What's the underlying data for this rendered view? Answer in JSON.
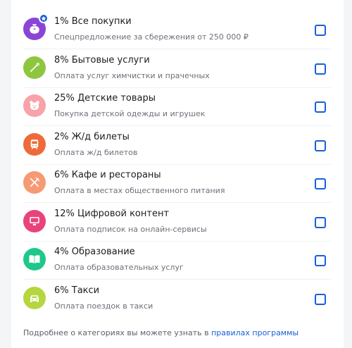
{
  "categories": [
    {
      "title": "1% Все покупки",
      "desc": "Спецпредложение за сбережения от 250 000 ₽",
      "icon": "wallet-icon",
      "color": "#8b45d6"
    },
    {
      "title": "8% Бытовые услуги",
      "desc": "Оплата услуг химчистки и прачечных",
      "icon": "needle-icon",
      "color": "#8ec63f"
    },
    {
      "title": "25% Детские товары",
      "desc": "Покупка детской одежды и игрушек",
      "icon": "teddy-bear-icon",
      "color": "#f7a3a9"
    },
    {
      "title": "2% Ж/д билеты",
      "desc": "Оплата ж/д билетов",
      "icon": "train-icon",
      "color": "#ee6a3a"
    },
    {
      "title": "6% Кафе и рестораны",
      "desc": "Оплата в местах общественного питания",
      "icon": "cutlery-icon",
      "color": "#f59a74"
    },
    {
      "title": "12% Цифровой контент",
      "desc": "Оплата подписок на онлайн-сервисы",
      "icon": "monitor-icon",
      "color": "#e9437a"
    },
    {
      "title": "4% Образование",
      "desc": "Оплата образовательных услуг",
      "icon": "book-icon",
      "color": "#1ec88a"
    },
    {
      "title": "6% Такси",
      "desc": "Оплата поездок в такси",
      "icon": "car-icon",
      "color": "#b6d63e"
    }
  ],
  "badge_icon": "star-icon",
  "accent": "#1a5ed8",
  "footer": {
    "text": "Подробнее о категориях вы можете узнать в ",
    "link": "правилах программы"
  }
}
